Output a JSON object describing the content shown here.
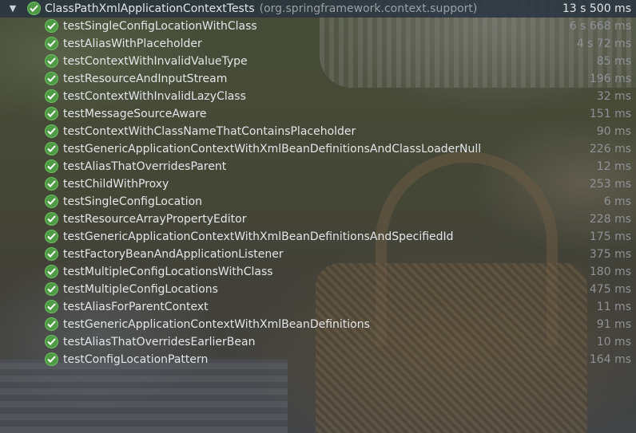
{
  "suite": {
    "name": "ClassPathXmlApplicationContextTests",
    "package": "(org.springframework.context.support)",
    "duration": "13 s 500 ms",
    "status_icon": "passed-check-icon"
  },
  "tests": [
    {
      "name": "testSingleConfigLocationWithClass",
      "duration": "6 s 668 ms"
    },
    {
      "name": "testAliasWithPlaceholder",
      "duration": "4 s 72 ms"
    },
    {
      "name": "testContextWithInvalidValueType",
      "duration": "85 ms"
    },
    {
      "name": "testResourceAndInputStream",
      "duration": "196 ms"
    },
    {
      "name": "testContextWithInvalidLazyClass",
      "duration": "32 ms"
    },
    {
      "name": "testMessageSourceAware",
      "duration": "151 ms"
    },
    {
      "name": "testContextWithClassNameThatContainsPlaceholder",
      "duration": "90 ms"
    },
    {
      "name": "testGenericApplicationContextWithXmlBeanDefinitionsAndClassLoaderNull",
      "duration": "226 ms"
    },
    {
      "name": "testAliasThatOverridesParent",
      "duration": "12 ms"
    },
    {
      "name": "testChildWithProxy",
      "duration": "253 ms"
    },
    {
      "name": "testSingleConfigLocation",
      "duration": "6 ms"
    },
    {
      "name": "testResourceArrayPropertyEditor",
      "duration": "228 ms"
    },
    {
      "name": "testGenericApplicationContextWithXmlBeanDefinitionsAndSpecifiedId",
      "duration": "175 ms"
    },
    {
      "name": "testFactoryBeanAndApplicationListener",
      "duration": "375 ms"
    },
    {
      "name": "testMultipleConfigLocationsWithClass",
      "duration": "180 ms"
    },
    {
      "name": "testMultipleConfigLocations",
      "duration": "475 ms"
    },
    {
      "name": "testAliasForParentContext",
      "duration": "11 ms"
    },
    {
      "name": "testGenericApplicationContextWithXmlBeanDefinitions",
      "duration": "91 ms"
    },
    {
      "name": "testAliasThatOverridesEarlierBean",
      "duration": "10 ms"
    },
    {
      "name": "testConfigLocationPattern",
      "duration": "164 ms"
    }
  ],
  "colors": {
    "pass_green": "#4f9a45",
    "selection": "#283440"
  }
}
